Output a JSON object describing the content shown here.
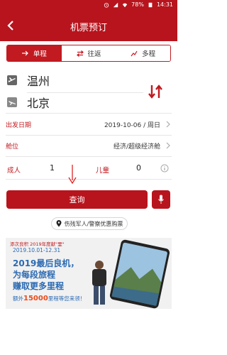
{
  "status_bar": {
    "battery": "78%",
    "time": "14:31"
  },
  "header": {
    "title": "机票预订"
  },
  "tabs": [
    {
      "label": "单程",
      "icon": "arrow-right-icon",
      "active": true
    },
    {
      "label": "往返",
      "icon": "swap-horizontal-icon",
      "active": false
    },
    {
      "label": "多程",
      "icon": "multi-leg-icon",
      "active": false
    }
  ],
  "route": {
    "from": "温州",
    "to": "北京"
  },
  "departure": {
    "label": "出发日期",
    "value": "2019-10-06 / 周日"
  },
  "cabin": {
    "label": "舱位",
    "value": "经济/超级经济舱"
  },
  "passengers": {
    "adult_label": "成人",
    "adult_count": "1",
    "child_label": "儿童",
    "child_count": "0"
  },
  "query_button": "查询",
  "discount_button": "伤残军人/警察优惠购票",
  "banner": {
    "line1": "添次良积 2019年度献\"里\"",
    "dates": "2019.10.01-12.31",
    "headline1": "2019最后良机，",
    "headline2": "为每段旅程",
    "headline3": "赚取更多里程",
    "bonus_prefix": "额外",
    "bonus_amount": "15000",
    "bonus_suffix": "里程等您来领！"
  },
  "colors": {
    "brand": "#b8141d",
    "accent_text": "#c11a20"
  }
}
